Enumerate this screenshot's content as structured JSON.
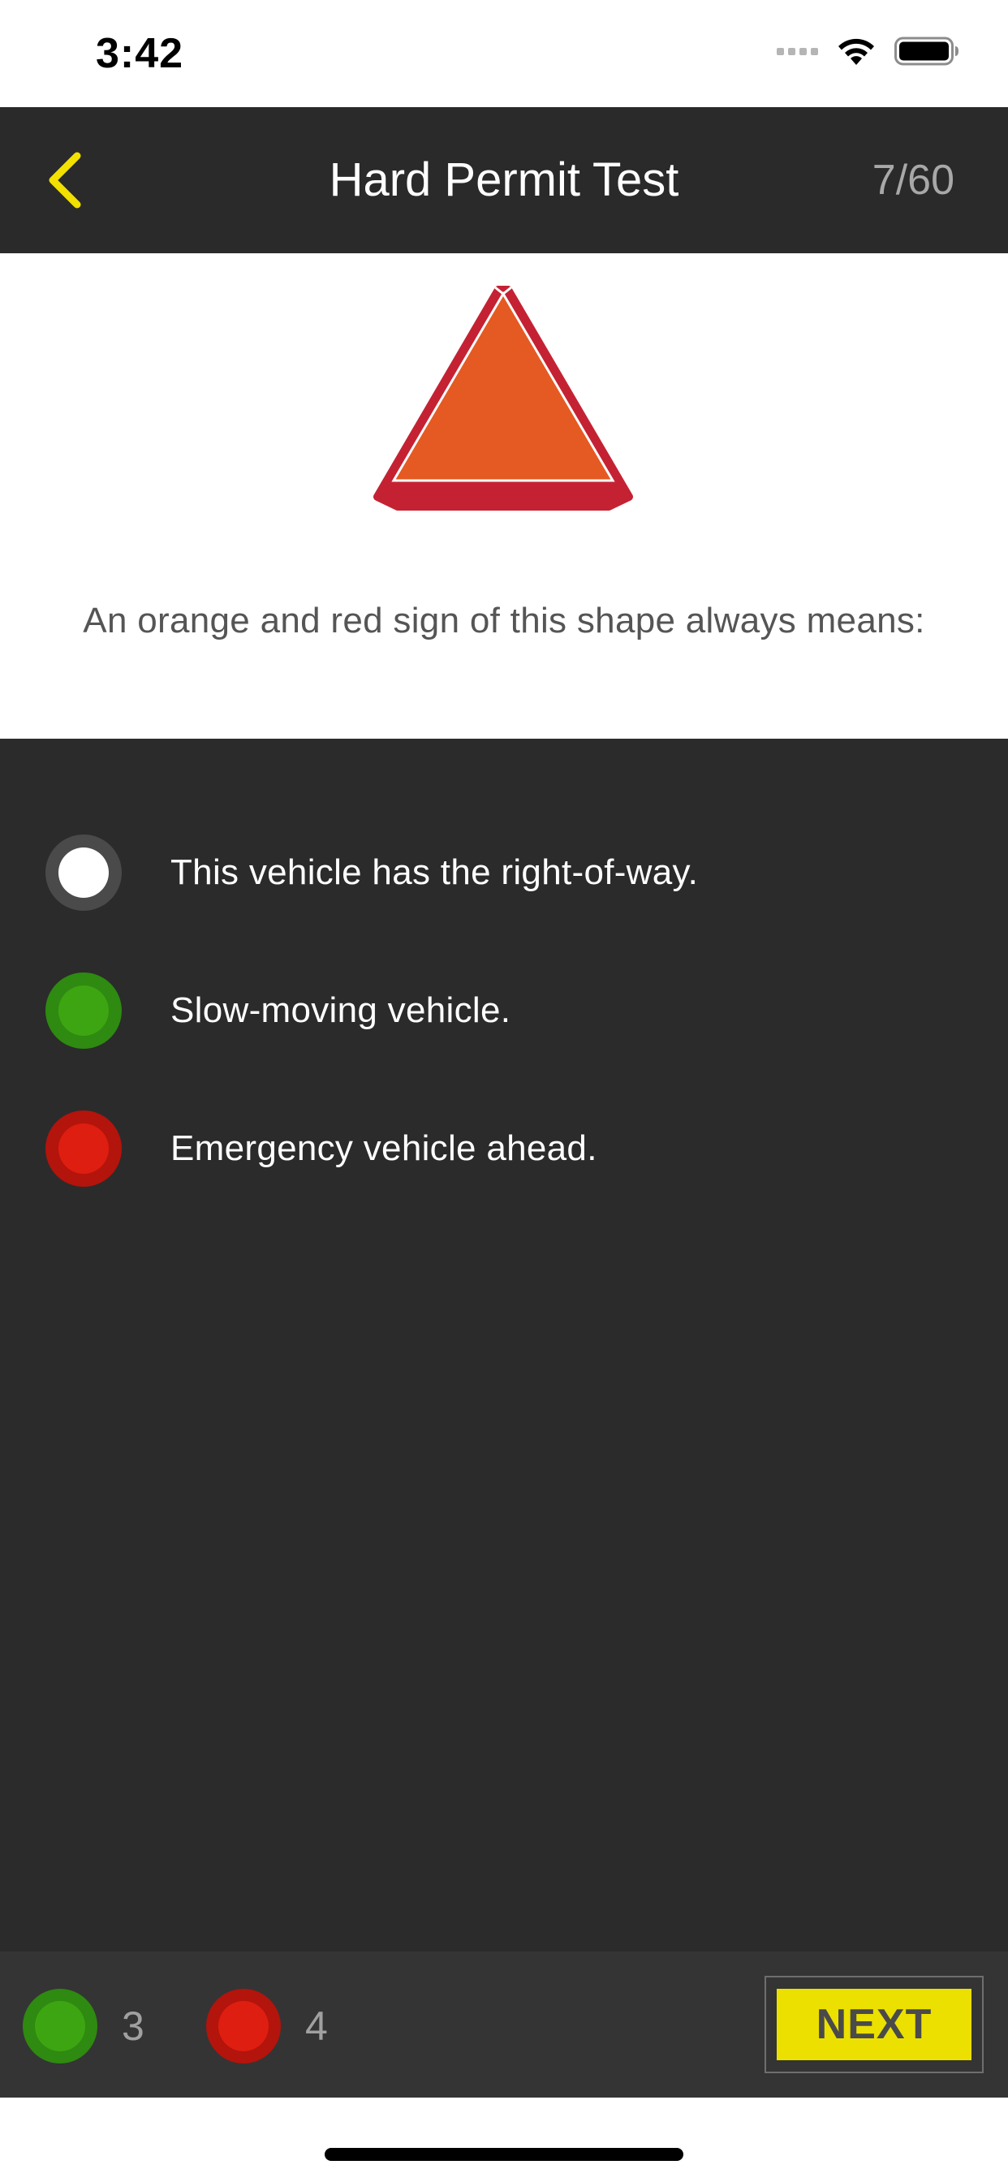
{
  "status_bar": {
    "time": "3:42"
  },
  "header": {
    "title": "Hard Permit Test",
    "progress": "7/60",
    "accent_color": "#f2e000"
  },
  "question": {
    "image_icon": "slow-moving-vehicle-sign",
    "text": "An orange and red sign of this shape always means:"
  },
  "answers": [
    {
      "label": "This vehicle has the right-of-way.",
      "state": "unselected"
    },
    {
      "label": "Slow-moving vehicle.",
      "state": "correct"
    },
    {
      "label": "Emergency vehicle ahead.",
      "state": "incorrect"
    }
  ],
  "footer": {
    "correct_count": "3",
    "incorrect_count": "4",
    "next_label": "NEXT"
  },
  "colors": {
    "correct": "#3ea512",
    "incorrect": "#de1e10",
    "next_button": "#ece000",
    "panel": "#2b2b2b"
  }
}
